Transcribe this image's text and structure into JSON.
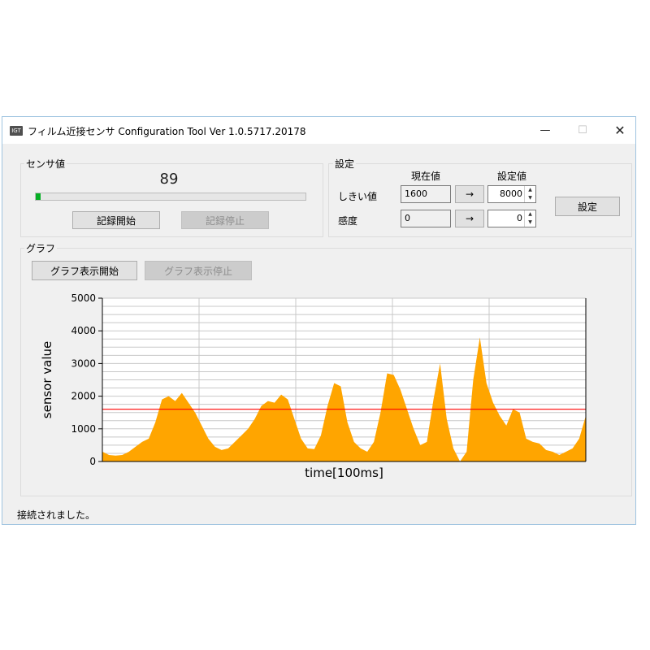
{
  "window": {
    "title": "フィルム近接センサ Configuration Tool Ver 1.0.5717.20178",
    "icon": "app-icon",
    "minimize_glyph": "—",
    "maximize_glyph": "☐",
    "close_glyph": "✕"
  },
  "sensor_group": {
    "title": "センサ値",
    "value": "89",
    "progress_fraction": 0.018,
    "start_record_label": "記録開始",
    "stop_record_label": "記録停止"
  },
  "settings_group": {
    "title": "設定",
    "current_header": "現在値",
    "setting_header": "設定値",
    "threshold_label": "しきい値",
    "threshold_current": "1600",
    "threshold_setting": "8000",
    "sensitivity_label": "感度",
    "sensitivity_current": "0",
    "sensitivity_setting": "0",
    "arrow_label": "→",
    "apply_label": "設定"
  },
  "graph_group": {
    "title": "グラフ",
    "start_graph_label": "グラフ表示開始",
    "stop_graph_label": "グラフ表示停止"
  },
  "chart_data": {
    "type": "area",
    "xlabel": "time[100ms]",
    "ylabel": "sensor value",
    "ylim": [
      0,
      5000
    ],
    "yticks": [
      "0",
      "1000",
      "2000",
      "3000",
      "4000",
      "5000"
    ],
    "grid": true,
    "threshold_line": 1600,
    "area_color": "#ffa500",
    "threshold_color": "#ff0000",
    "values": [
      300,
      200,
      180,
      200,
      300,
      450,
      600,
      700,
      1200,
      1900,
      2000,
      1850,
      2100,
      1800,
      1500,
      1100,
      700,
      450,
      350,
      400,
      600,
      800,
      1000,
      1300,
      1700,
      1850,
      1800,
      2050,
      1900,
      1300,
      700,
      400,
      380,
      800,
      1700,
      2400,
      2300,
      1200,
      600,
      400,
      300,
      600,
      1500,
      2700,
      2650,
      2200,
      1600,
      1000,
      500,
      600,
      1900,
      3000,
      1300,
      400,
      0,
      300,
      2500,
      3800,
      2400,
      1800,
      1400,
      1100,
      1600,
      1500,
      700,
      600,
      550,
      350,
      300,
      200,
      300,
      400,
      700,
      1400
    ]
  },
  "status": {
    "text": "接続されました。"
  }
}
